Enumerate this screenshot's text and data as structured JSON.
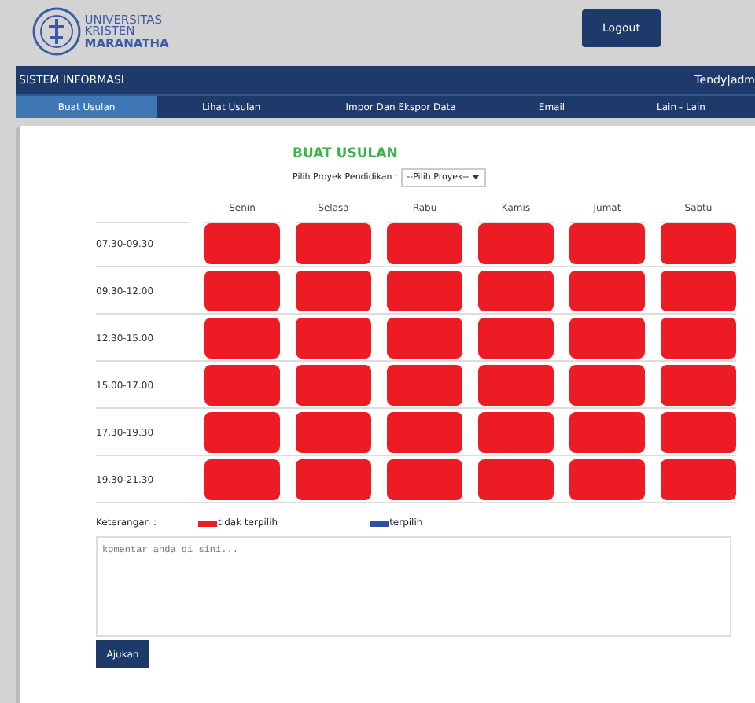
{
  "header": {
    "logo_lines": [
      "UNIVERSITAS",
      "KRISTEN",
      "MARANATHA"
    ],
    "logout_button": "Logout"
  },
  "navbar": {
    "title": "SISTEM INFORMASI",
    "user": "Tendy|adm"
  },
  "tabs": [
    {
      "label": "Buat Usulan",
      "selected": true
    },
    {
      "label": "Lihat Usulan",
      "selected": false
    },
    {
      "label": "Impor Dan Ekspor Data",
      "selected": false
    },
    {
      "label": "Email",
      "selected": false
    },
    {
      "label": "Lain - Lain",
      "selected": false
    }
  ],
  "form": {
    "title": "BUAT USULAN",
    "project_label": "Pilih Proyek Pendidikan :",
    "project_select": "--Pilih Proyek--"
  },
  "schedule": {
    "days": [
      "Senin",
      "Selasa",
      "Rabu",
      "Kamis",
      "Jumat",
      "Sabtu"
    ],
    "rows": [
      {
        "time": "07.30-09.30",
        "slots": [
          {
            "selected": false
          },
          {
            "selected": false
          },
          {
            "selected": false
          },
          {
            "selected": false
          },
          {
            "selected": false
          },
          {
            "selected": false
          }
        ]
      },
      {
        "time": "09.30-12.00",
        "slots": [
          {
            "selected": false
          },
          {
            "selected": false
          },
          {
            "selected": false
          },
          {
            "selected": false
          },
          {
            "selected": false
          },
          {
            "selected": false
          }
        ]
      },
      {
        "time": "12.30-15.00",
        "slots": [
          {
            "selected": false
          },
          {
            "selected": false
          },
          {
            "selected": false
          },
          {
            "selected": false
          },
          {
            "selected": false
          },
          {
            "selected": false
          }
        ]
      },
      {
        "time": "15.00-17.00",
        "slots": [
          {
            "selected": false
          },
          {
            "selected": false
          },
          {
            "selected": false
          },
          {
            "selected": false
          },
          {
            "selected": false
          },
          {
            "selected": false
          }
        ]
      },
      {
        "time": "17.30-19.30",
        "slots": [
          {
            "selected": false
          },
          {
            "selected": false
          },
          {
            "selected": false
          },
          {
            "selected": false
          },
          {
            "selected": false
          },
          {
            "selected": false
          }
        ]
      },
      {
        "time": "19.30-21.30",
        "slots": [
          {
            "selected": false
          },
          {
            "selected": false
          },
          {
            "selected": false
          },
          {
            "selected": false
          },
          {
            "selected": false
          },
          {
            "selected": false
          }
        ]
      }
    ]
  },
  "legend": {
    "label": "Keterangan :",
    "items": [
      {
        "label": "tidak terpilih",
        "color": "#ed1c24"
      },
      {
        "label": "terpilih",
        "color": "#2e4ea3"
      }
    ]
  },
  "comment": {
    "placeholder": "komentar anda di sini..."
  },
  "submit_button": "Ajukan"
}
